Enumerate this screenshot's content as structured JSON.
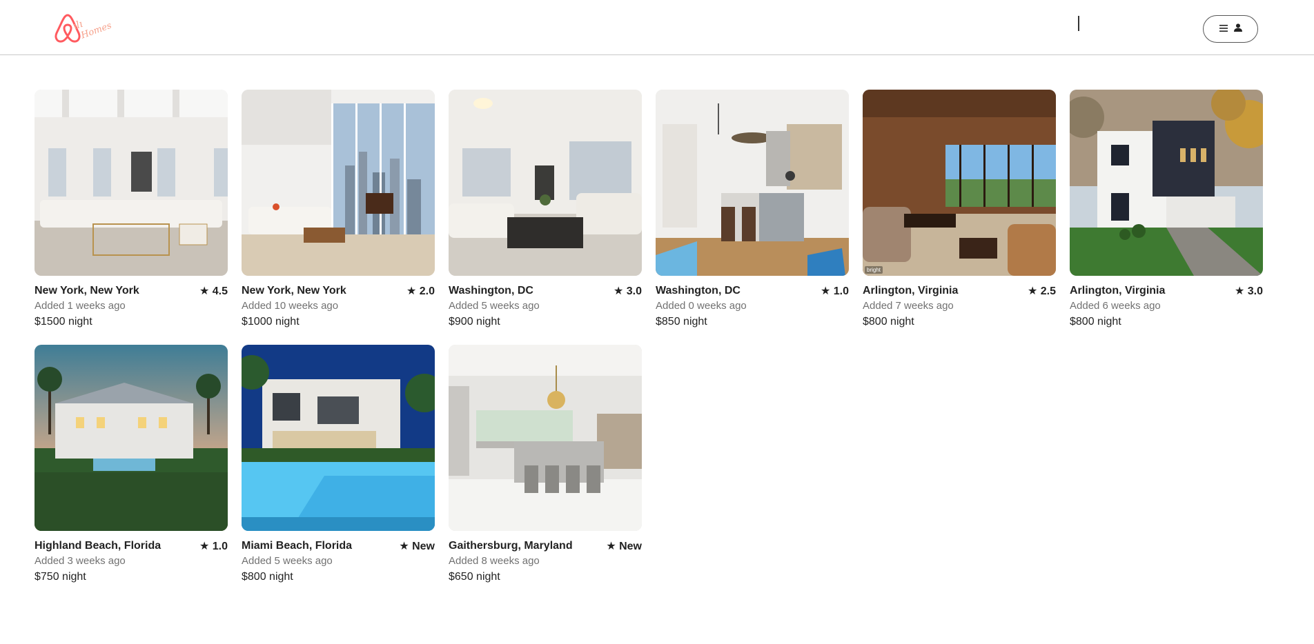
{
  "header": {
    "logo_icon": "airbnb-logo-icon",
    "menu_icon": "hamburger-icon",
    "profile_icon": "user-icon"
  },
  "listings": [
    {
      "location": "New York, New York",
      "rating": "★ 4.5",
      "added": "Added 1 weeks ago",
      "price": "$1500 night",
      "photo": "white-living-room",
      "watermark": ""
    },
    {
      "location": "New York, New York",
      "rating": "★ 2.0",
      "added": "Added 10 weeks ago",
      "price": "$1000 night",
      "photo": "penthouse-living-room-city-view",
      "watermark": ""
    },
    {
      "location": "Washington, DC",
      "rating": "★ 3.0",
      "added": "Added 5 weeks ago",
      "price": "$900 night",
      "photo": "living-room-windows",
      "watermark": ""
    },
    {
      "location": "Washington, DC",
      "rating": "★ 1.0",
      "added": "Added 0 weeks ago",
      "price": "$850 night",
      "photo": "kitchen-island",
      "watermark": ""
    },
    {
      "location": "Arlington, Virginia",
      "rating": "★ 2.5",
      "added": "Added 7 weeks ago",
      "price": "$800 night",
      "photo": "wood-paneled-living-room",
      "watermark": "bright"
    },
    {
      "location": "Arlington, Virginia",
      "rating": "★ 3.0",
      "added": "Added 6 weeks ago",
      "price": "$800 night",
      "photo": "modern-house-exterior",
      "watermark": ""
    },
    {
      "location": "Highland Beach, Florida",
      "rating": "★ 1.0",
      "added": "Added 3 weeks ago",
      "price": "$750 night",
      "photo": "beach-estate-sunset",
      "watermark": ""
    },
    {
      "location": "Miami Beach, Florida",
      "rating": "★ New",
      "added": "Added 5 weeks ago",
      "price": "$800 night",
      "photo": "modern-villa-pool",
      "watermark": ""
    },
    {
      "location": "Gaithersburg, Maryland",
      "rating": "★ New",
      "added": "Added 8 weeks ago",
      "price": "$650 night",
      "photo": "kitchen-chandelier",
      "watermark": ""
    }
  ],
  "colors": {
    "brand": "#ff5a5f",
    "text_primary": "#222222",
    "text_secondary": "#717171",
    "divider": "#c8c8c8"
  }
}
